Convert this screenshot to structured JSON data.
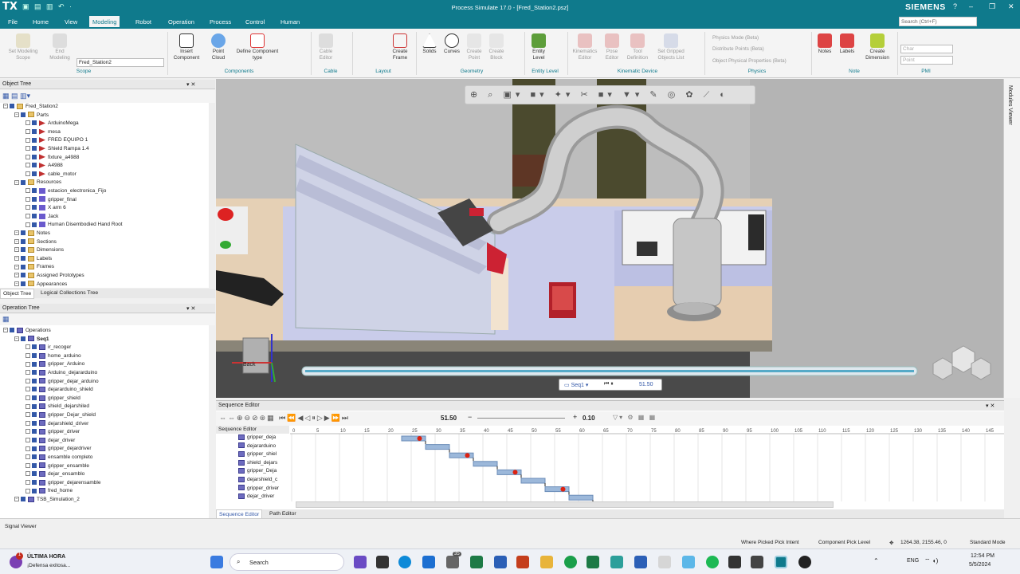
{
  "app": {
    "logo": "TX",
    "title": "Process Simulate 17.0 - [Fred_Station2.psz]",
    "brand": "SIEMENS",
    "window_controls": [
      "?",
      "–",
      "❐",
      "✕"
    ]
  },
  "menu": [
    "File",
    "Home",
    "View",
    "Modeling",
    "Robot",
    "Operation",
    "Process",
    "Control",
    "Human"
  ],
  "search_placeholder": "Search (Ctrl+F)",
  "ribbon": {
    "scope": {
      "set_modeling": "Set Modeling Scope",
      "end_modeling": "End Modeling",
      "combo": "Fred_Station2",
      "group": "Scope"
    },
    "components": {
      "insert": "Insert Component",
      "point_cloud": "Point Cloud",
      "define": "Define Component type",
      "group": "Components"
    },
    "cable": {
      "editor": "Cable Editor",
      "group": "Cable"
    },
    "layout": {
      "create_frame": "Create Frame",
      "group": "Layout"
    },
    "geometry": {
      "solids": "Solids",
      "curves": "Curves",
      "create_point": "Create Point",
      "create_block": "Create Block",
      "group": "Geometry"
    },
    "entity": {
      "entity_level": "Entity Level",
      "group": "Entity Level"
    },
    "kinematic": {
      "editor": "Kinematics Editor",
      "pose": "Pose Editor",
      "tool": "Tool Definition",
      "gripped": "Set Gripped Objects List",
      "group": "Kinematic Device"
    },
    "physics": {
      "mode": "Physics Mode (Beta)",
      "distribute": "Distribute Points (Beta)",
      "props": "Object Physical Properties (Beta)",
      "group": "Physics"
    },
    "note": {
      "notes": "Notes",
      "labels": "Labels",
      "dimension": "Create Dimension",
      "group": "Note"
    },
    "pmi": {
      "combo1": "Char",
      "combo2": "Point",
      "group": "PMI"
    }
  },
  "object_tree": {
    "title": "Object Tree",
    "rows": [
      {
        "label": "Fred_Station2",
        "level": 0,
        "icon": "fold"
      },
      {
        "label": "Parts",
        "level": 1,
        "icon": "fold"
      },
      {
        "label": "ArduinoMega",
        "level": 2,
        "icon": "part"
      },
      {
        "label": "mesa",
        "level": 2,
        "icon": "part"
      },
      {
        "label": "FRED EQUIPO 1",
        "level": 2,
        "icon": "part"
      },
      {
        "label": "Shield Rampa 1.4",
        "level": 2,
        "icon": "part"
      },
      {
        "label": "fixture_a4988",
        "level": 2,
        "icon": "part"
      },
      {
        "label": "A4988",
        "level": 2,
        "icon": "part"
      },
      {
        "label": "cable_motor",
        "level": 2,
        "icon": "part"
      },
      {
        "label": "Resources",
        "level": 1,
        "icon": "fold"
      },
      {
        "label": "estacion_electronica_Fijo",
        "level": 2,
        "icon": "res"
      },
      {
        "label": "gripper_final",
        "level": 2,
        "icon": "res"
      },
      {
        "label": "X arm 6",
        "level": 2,
        "icon": "res"
      },
      {
        "label": "Jack",
        "level": 2,
        "icon": "res"
      },
      {
        "label": "Human Disembodied Hand Root",
        "level": 2,
        "icon": "res"
      },
      {
        "label": "Notes",
        "level": 1,
        "icon": "fold"
      },
      {
        "label": "Sections",
        "level": 1,
        "icon": "fold"
      },
      {
        "label": "Dimensions",
        "level": 1,
        "icon": "fold"
      },
      {
        "label": "Labels",
        "level": 1,
        "icon": "fold"
      },
      {
        "label": "Frames",
        "level": 1,
        "icon": "fold"
      },
      {
        "label": "Assigned Prototypes",
        "level": 1,
        "icon": "fold"
      },
      {
        "label": "Appearances",
        "level": 1,
        "icon": "fold"
      }
    ],
    "tabs": [
      "Object Tree",
      "Logical Collections Tree"
    ]
  },
  "operation_tree": {
    "title": "Operation Tree",
    "rows": [
      {
        "label": "Operations",
        "level": 0
      },
      {
        "label": "Seq1",
        "level": 1
      },
      {
        "label": "ir_recoger",
        "level": 2
      },
      {
        "label": "home_arduino",
        "level": 2
      },
      {
        "label": "gripper_Arduino",
        "level": 2
      },
      {
        "label": "Arduino_dejararduino",
        "level": 2
      },
      {
        "label": "gripper_dejar_arduino",
        "level": 2
      },
      {
        "label": "dejararduino_shield",
        "level": 2
      },
      {
        "label": "gripper_shield",
        "level": 2
      },
      {
        "label": "shield_dejarshiled",
        "level": 2
      },
      {
        "label": "gripper_Dejar_shield",
        "level": 2
      },
      {
        "label": "dejarshield_driver",
        "level": 2
      },
      {
        "label": "gripper_driver",
        "level": 2
      },
      {
        "label": "dejar_driver",
        "level": 2
      },
      {
        "label": "gripper_dejardriver",
        "level": 2
      },
      {
        "label": "ensamble completo",
        "level": 2
      },
      {
        "label": "gripper_ensamble",
        "level": 2
      },
      {
        "label": "dejar_ensamblo",
        "level": 2
      },
      {
        "label": "gripper_dejarensamble",
        "level": 2
      },
      {
        "label": "fred_home",
        "level": 2
      },
      {
        "label": "TSB_Simulation_2",
        "level": 1
      }
    ]
  },
  "viewer": {
    "side_label": "Modules Viewer",
    "back_label": "Back",
    "player": {
      "seq": "Seq1",
      "time": "51.50"
    }
  },
  "sequence_editor": {
    "title": "Sequence Editor",
    "time": "51.50",
    "step": "0.10",
    "col_header": "Sequence Editor",
    "ticks": [
      "0",
      "5",
      "10",
      "15",
      "20",
      "25",
      "30",
      "35",
      "40",
      "45",
      "50",
      "55",
      "60",
      "65",
      "70",
      "75",
      "80",
      "85",
      "90",
      "95",
      "100",
      "105",
      "110",
      "115",
      "120",
      "125",
      "130",
      "135",
      "140",
      "145"
    ],
    "rows": [
      "gripper_deja",
      "dejararduino",
      "gripper_shiel",
      "shield_dejars",
      "gripper_Deja",
      "dejarshield_c",
      "gripper_driver",
      "dejar_driver"
    ],
    "bars": [
      {
        "start": 23,
        "end": 28
      },
      {
        "start": 28,
        "end": 33
      },
      {
        "start": 33,
        "end": 38
      },
      {
        "start": 38,
        "end": 43
      },
      {
        "start": 43,
        "end": 48
      },
      {
        "start": 48,
        "end": 53
      },
      {
        "start": 53,
        "end": 58
      },
      {
        "start": 58,
        "end": 63
      }
    ],
    "tabs": [
      "Sequence Editor",
      "Path Editor"
    ]
  },
  "status": {
    "signal_viewer": "Signal Viewer",
    "pick_intent": "Where Picked Pick Intent",
    "pick_level": "Component Pick Level",
    "coords": "1264.38, 2155.46, 0",
    "mode": "Standard Mode"
  },
  "taskbar": {
    "news_title": "ÚLTIMA HORA",
    "news_sub": "¡Defensa exitosa...",
    "search": "Search",
    "lang": "ENG",
    "time": "12:54 PM",
    "date": "5/5/2024",
    "badge1": "1",
    "badge2": "35"
  }
}
